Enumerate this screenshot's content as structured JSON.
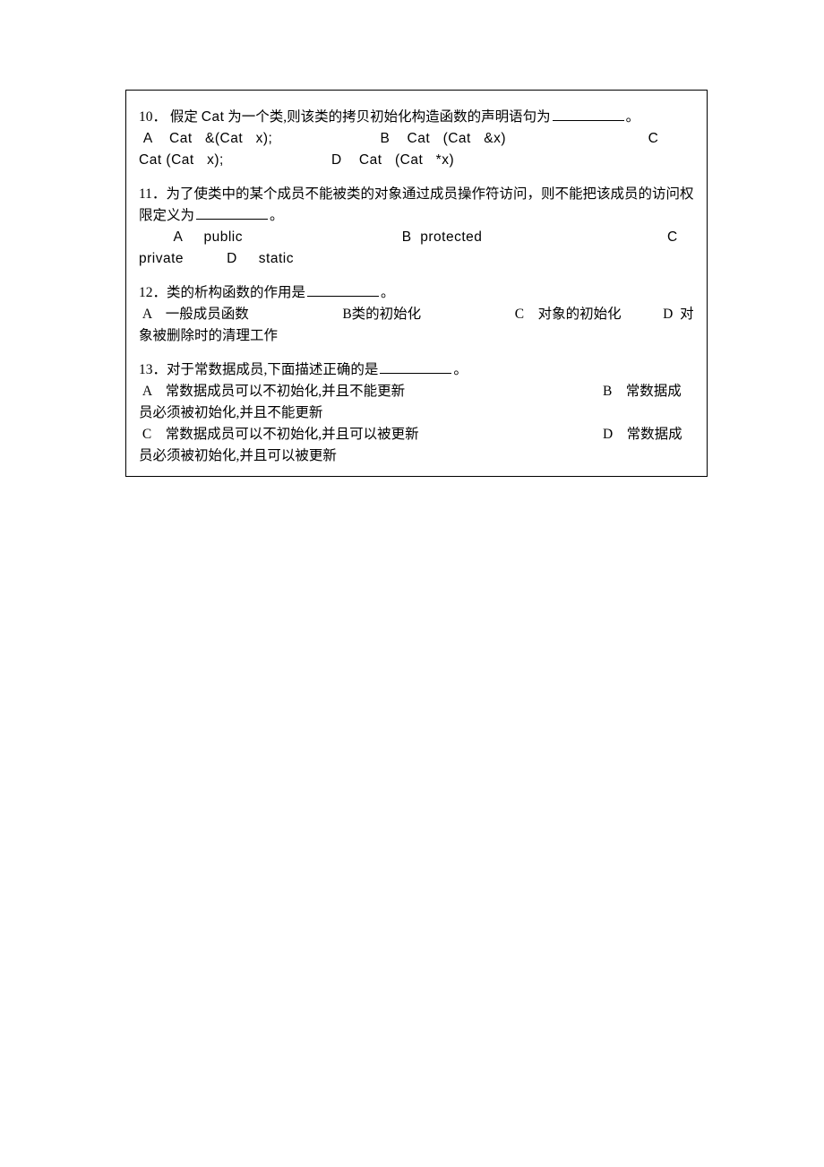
{
  "questions": {
    "q10": {
      "number": "10．",
      "stem_prefix": "假定 ",
      "stem_cat": "Cat",
      "stem_suffix": " 为一个类,则该类的拷贝初始化构造函数的声明语句为",
      "period": "。",
      "optA": " A    Cat   &(Cat   x);                         B    Cat   (Cat   &x)                                 C    Cat (Cat   x);                         D    Cat   (Cat   *x)"
    },
    "q11": {
      "number": "11．",
      "stem": "为了使类中的某个成员不能被类的对象通过成员操作符访问，则不能把该成员的访问权限定义为",
      "period": "。",
      "opts": "        A     public                                     B  protected                                           C private          D     static"
    },
    "q12": {
      "number": "12．",
      "stem": "类的析构函数的作用是",
      "period": "。",
      "opts": " A    一般成员函数                           B类的初始化                           C    对象的初始化            D  对象被删除时的清理工作"
    },
    "q13": {
      "number": "13．",
      "stem": "对于常数据成员,下面描述正确的是",
      "period": "。",
      "line1": " A    常数据成员可以不初始化,并且不能更新                                                         B    常数据成员必须被初始化,并且不能更新",
      "line2": " C    常数据成员可以不初始化,并且可以被更新                                                     D    常数据成员必须被初始化,并且可以被更新"
    }
  }
}
